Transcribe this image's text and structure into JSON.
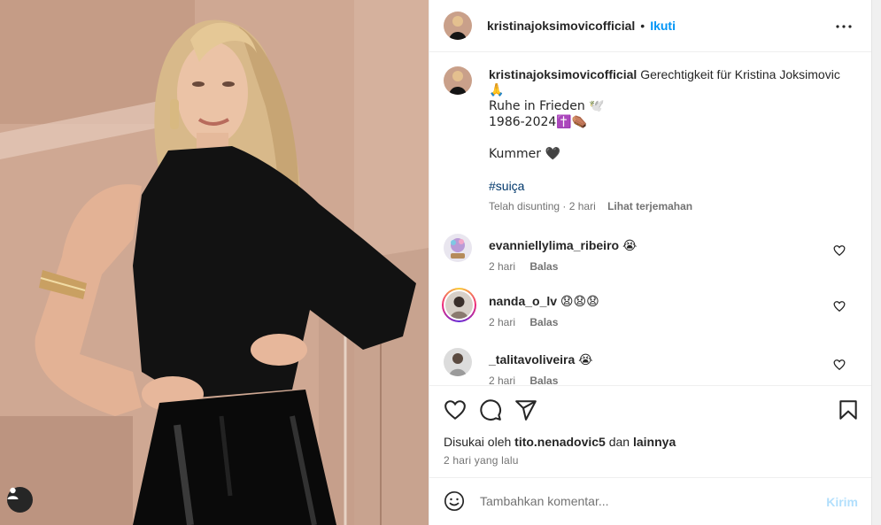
{
  "post": {
    "author": "kristinajoksimovicofficial",
    "dot": "•",
    "follow_label": "Ikuti",
    "more_icon": "more-horizontal-icon"
  },
  "caption": {
    "username": "kristinajoksimovicofficial",
    "lines": [
      "Gerechtigkeit für Kristina Joksimovic",
      "🙏",
      "Ruhe in Frieden 🕊️",
      "1986-2024✝️⚰️",
      "",
      "Kummer 🖤",
      "",
      "#suiça"
    ],
    "meta": "Telah disunting · 2 hari",
    "translate_label": "Lihat terjemahan"
  },
  "comments": [
    {
      "username": "evanniellylima_ribeiro",
      "text": "😭",
      "time": "2 hari",
      "reply": "Balas"
    },
    {
      "username": "nanda_o_lv",
      "text": "😧😧😧",
      "time": "2 hari",
      "reply": "Balas"
    },
    {
      "username": "_talitavoliveira",
      "text": "😭",
      "time": "2 hari",
      "reply": "Balas"
    }
  ],
  "actions": {
    "icons": [
      "heart-icon",
      "comment-icon",
      "share-icon",
      "bookmark-icon"
    ],
    "liked_by_prefix": "Disukai oleh",
    "liked_by_user": "tito.nenadovic5",
    "liked_by_join": "dan",
    "liked_by_others": "lainnya",
    "timestamp": "2 hari yang lalu"
  },
  "add_comment": {
    "placeholder": "Tambahkan komentar...",
    "post_label": "Kirim"
  },
  "colors": {
    "link_blue": "#0095f6",
    "hashtag_blue": "#00376b",
    "muted": "#737373",
    "post_disabled": "#b2dffc",
    "story_ring_start": "#f9ce34",
    "story_ring_end": "#ee2a7b"
  }
}
